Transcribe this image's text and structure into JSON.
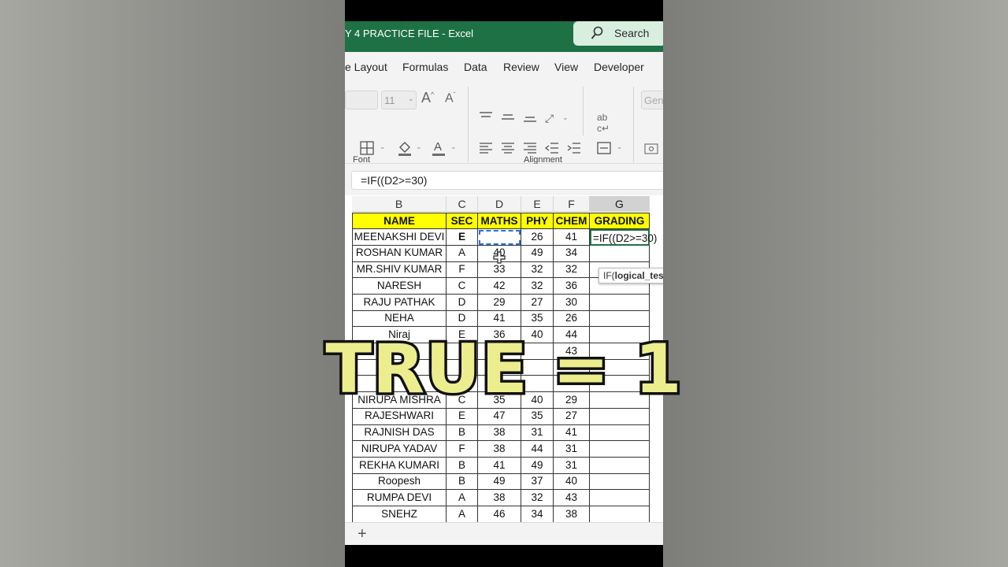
{
  "window": {
    "title": "Y 4 PRACTICE FILE  -  Excel"
  },
  "search": {
    "label": "Search",
    "icon": "search-icon"
  },
  "menu": [
    "e Layout",
    "Formulas",
    "Data",
    "Review",
    "View",
    "Developer"
  ],
  "ribbon": {
    "font_size": "11",
    "number_format": "Gene",
    "groups": [
      "Font",
      "Alignment"
    ]
  },
  "formula_bar": {
    "text": "=IF((D2>=30)"
  },
  "sheet": {
    "columns": [
      "B",
      "C",
      "D",
      "E",
      "F",
      "G"
    ],
    "selected_column": "G",
    "header": [
      "NAME",
      "SEC",
      "MATHS",
      "PHY",
      "CHEM",
      "GRADING"
    ],
    "rows": [
      [
        "MEENAKSHI DEVI",
        "E",
        "",
        "26",
        "41",
        "=IF((D2>=30)"
      ],
      [
        "ROSHAN KUMAR",
        "A",
        "40",
        "49",
        "34",
        ""
      ],
      [
        "MR.SHIV KUMAR",
        "F",
        "33",
        "32",
        "32",
        ""
      ],
      [
        "NARESH",
        "C",
        "42",
        "32",
        "36",
        ""
      ],
      [
        "RAJU PATHAK",
        "D",
        "29",
        "27",
        "30",
        ""
      ],
      [
        "NEHA",
        "D",
        "41",
        "35",
        "26",
        ""
      ],
      [
        "Niraj",
        "E",
        "36",
        "40",
        "44",
        ""
      ],
      [
        "",
        "",
        "",
        "",
        "43",
        ""
      ],
      [
        "",
        "",
        "",
        "",
        "",
        ""
      ],
      [
        "",
        "",
        "",
        "",
        "",
        ""
      ],
      [
        "NIRUPA MISHRA",
        "C",
        "35",
        "40",
        "29",
        ""
      ],
      [
        "RAJESHWARI",
        "E",
        "47",
        "35",
        "27",
        ""
      ],
      [
        "RAJNISH DAS",
        "B",
        "38",
        "31",
        "41",
        ""
      ],
      [
        "NIRUPA YADAV",
        "F",
        "38",
        "44",
        "31",
        ""
      ],
      [
        "REKHA KUMARI",
        "B",
        "41",
        "49",
        "31",
        ""
      ],
      [
        "Roopesh",
        "B",
        "49",
        "37",
        "40",
        ""
      ],
      [
        "RUMPA DEVI",
        "A",
        "38",
        "32",
        "43",
        ""
      ],
      [
        "SNEHZ",
        "A",
        "46",
        "34",
        "38",
        ""
      ]
    ],
    "tooltip": "IF(logical_test"
  },
  "overlay_text": "TRUE = 1",
  "colors": {
    "excel_green": "#1e7145",
    "header_yellow": "#ffff00",
    "overlay_fill": "#ecee8e"
  }
}
